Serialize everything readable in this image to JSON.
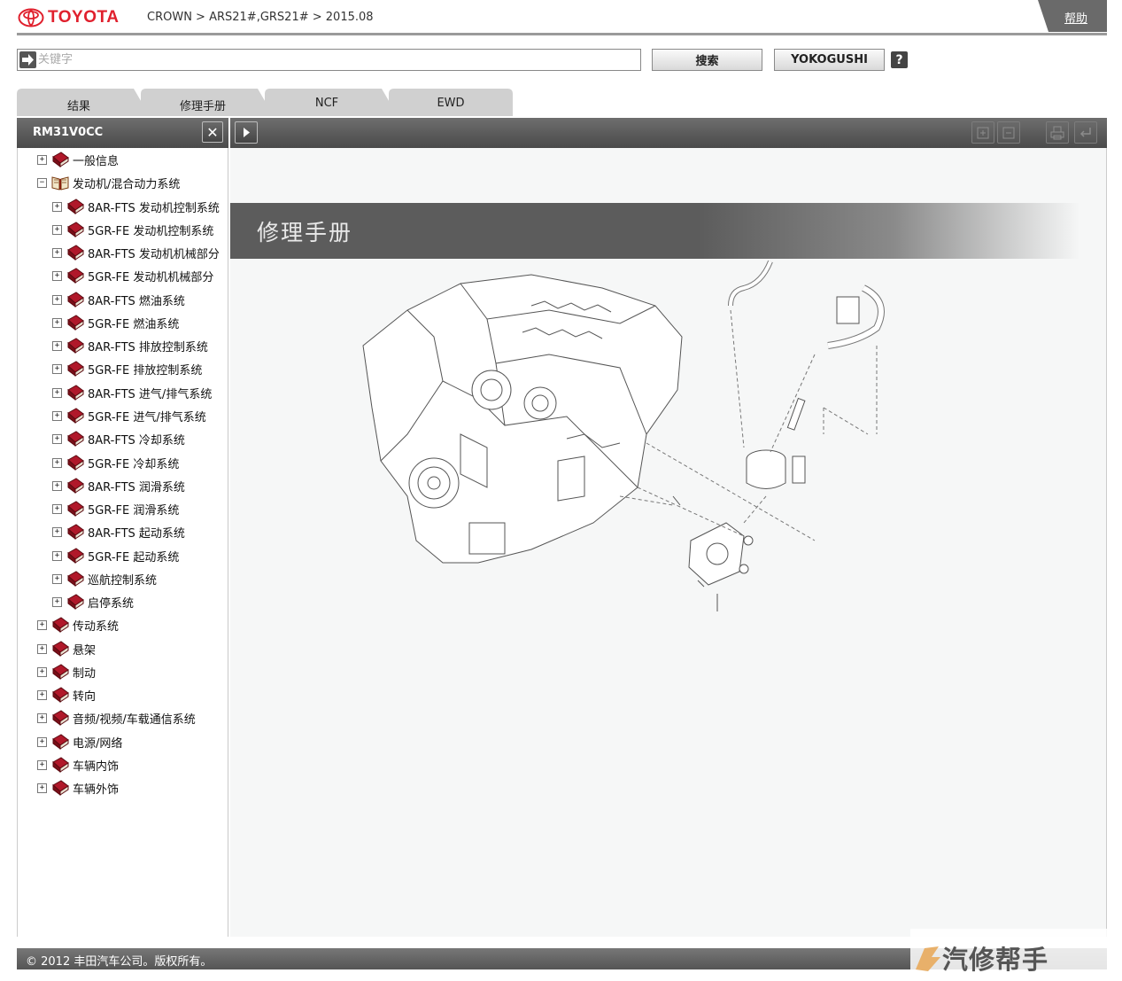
{
  "header": {
    "logo_text": "TOYOTA",
    "breadcrumb": "CROWN > ARS21#,GRS21# > 2015.08",
    "help_label": "帮助"
  },
  "search": {
    "placeholder": "关键字",
    "value": "",
    "search_button": "搜索",
    "yokogushi_button": "YOKOGUSHI",
    "help_button": "?"
  },
  "tabs": [
    {
      "label": "结果"
    },
    {
      "label": "修理手册"
    },
    {
      "label": "NCF"
    },
    {
      "label": "EWD"
    }
  ],
  "left_panel": {
    "doc_id": "RM31V0CC",
    "close_label": "✕"
  },
  "tree": [
    {
      "label": "一般信息",
      "level": 0,
      "expanded": false
    },
    {
      "label": "发动机/混合动力系统",
      "level": 0,
      "expanded": true
    },
    {
      "label": "8AR-FTS 发动机控制系统",
      "level": 1,
      "expanded": false
    },
    {
      "label": "5GR-FE 发动机控制系统",
      "level": 1,
      "expanded": false
    },
    {
      "label": "8AR-FTS 发动机机械部分",
      "level": 1,
      "expanded": false
    },
    {
      "label": "5GR-FE 发动机机械部分",
      "level": 1,
      "expanded": false
    },
    {
      "label": "8AR-FTS 燃油系统",
      "level": 1,
      "expanded": false
    },
    {
      "label": "5GR-FE 燃油系统",
      "level": 1,
      "expanded": false
    },
    {
      "label": "8AR-FTS 排放控制系统",
      "level": 1,
      "expanded": false
    },
    {
      "label": "5GR-FE 排放控制系统",
      "level": 1,
      "expanded": false
    },
    {
      "label": "8AR-FTS 进气/排气系统",
      "level": 1,
      "expanded": false
    },
    {
      "label": "5GR-FE 进气/排气系统",
      "level": 1,
      "expanded": false
    },
    {
      "label": "8AR-FTS 冷却系统",
      "level": 1,
      "expanded": false
    },
    {
      "label": "5GR-FE 冷却系统",
      "level": 1,
      "expanded": false
    },
    {
      "label": "8AR-FTS 润滑系统",
      "level": 1,
      "expanded": false
    },
    {
      "label": "5GR-FE 润滑系统",
      "level": 1,
      "expanded": false
    },
    {
      "label": "8AR-FTS 起动系统",
      "level": 1,
      "expanded": false
    },
    {
      "label": "5GR-FE 起动系统",
      "level": 1,
      "expanded": false
    },
    {
      "label": "巡航控制系统",
      "level": 1,
      "expanded": false
    },
    {
      "label": "启停系统",
      "level": 1,
      "expanded": false
    },
    {
      "label": "传动系统",
      "level": 0,
      "expanded": false
    },
    {
      "label": "悬架",
      "level": 0,
      "expanded": false
    },
    {
      "label": "制动",
      "level": 0,
      "expanded": false
    },
    {
      "label": "转向",
      "level": 0,
      "expanded": false
    },
    {
      "label": "音频/视频/车载通信系统",
      "level": 0,
      "expanded": false
    },
    {
      "label": "电源/网络",
      "level": 0,
      "expanded": false
    },
    {
      "label": "车辆内饰",
      "level": 0,
      "expanded": false
    },
    {
      "label": "车辆外饰",
      "level": 0,
      "expanded": false
    }
  ],
  "content": {
    "banner_title": "修理手册"
  },
  "footer": {
    "copyright": "© 2012 丰田汽车公司。版权所有。"
  },
  "watermark": {
    "text": "汽修帮手"
  },
  "colors": {
    "brand_red": "#e0202d",
    "bar_gray": "#555555",
    "book_red": "#b0182a"
  }
}
